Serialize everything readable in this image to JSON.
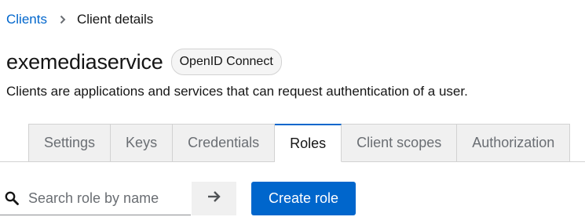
{
  "breadcrumb": {
    "parent": "Clients",
    "current": "Client details"
  },
  "header": {
    "title": "exemediaservice",
    "protocol_badge": "OpenID Connect",
    "subtitle": "Clients are applications and services that can request authentication of a user."
  },
  "tabs": [
    {
      "label": "Settings",
      "active": false
    },
    {
      "label": "Keys",
      "active": false
    },
    {
      "label": "Credentials",
      "active": false
    },
    {
      "label": "Roles",
      "active": true
    },
    {
      "label": "Client scopes",
      "active": false
    },
    {
      "label": "Authorization",
      "active": false
    }
  ],
  "toolbar": {
    "search_placeholder": "Search role by name",
    "search_value": "",
    "create_label": "Create role"
  },
  "colors": {
    "link": "#0066cc",
    "primary_button": "#0066cc",
    "tab_inactive_bg": "#f0f0f0"
  },
  "icons": {
    "breadcrumb_separator": "chevron-right-icon",
    "search": "search-icon",
    "search_submit": "arrow-right-icon"
  }
}
